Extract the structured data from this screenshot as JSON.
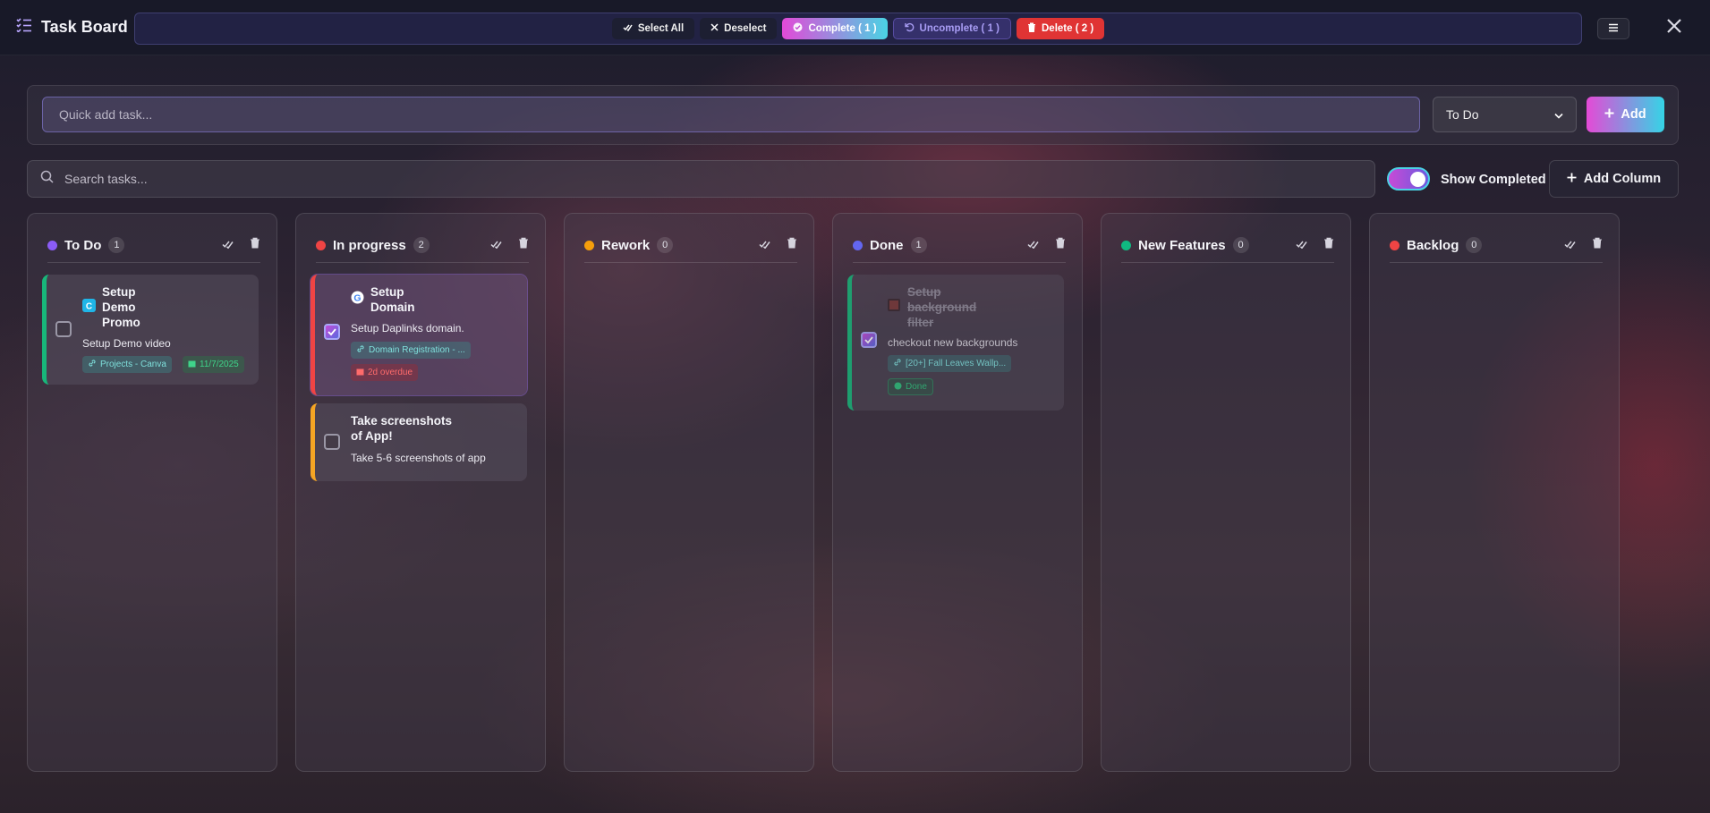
{
  "app": {
    "title": "Task Board"
  },
  "actions": {
    "select_all": "Select All",
    "deselect": "Deselect",
    "complete_label": "Complete ( 1 )",
    "uncomplete_label": "Uncomplete ( 1 )",
    "delete_label": "Delete ( 2 )"
  },
  "quick_add": {
    "placeholder": "Quick add task...",
    "column_value": "To Do",
    "add_label": "Add"
  },
  "search": {
    "placeholder": "Search tasks..."
  },
  "show_completed": {
    "label": "Show Completed",
    "on": true
  },
  "add_column_label": "Add Column",
  "columns": [
    {
      "title": "To Do",
      "count": "1",
      "color": "#8b5cf6",
      "cards": [
        {
          "title_lines": [
            "Setup",
            "Demo",
            "Promo"
          ],
          "description": "Setup Demo video",
          "link": "Projects - Canva",
          "date": "11/7/2025",
          "checked": false,
          "accent": "#18b77a",
          "icon": "canva-icon"
        }
      ]
    },
    {
      "title": "In progress",
      "count": "2",
      "color": "#ef4444",
      "cards": [
        {
          "title_lines": [
            "Setup",
            "Domain"
          ],
          "description": "Setup Daplinks domain.",
          "link": "Domain Registration - ...",
          "overdue": "2d overdue",
          "checked": true,
          "accent": "#ef4444",
          "icon": "google-icon"
        },
        {
          "title_lines": [
            "Take screenshots",
            "of App!"
          ],
          "description": "Take 5-6 screenshots of app",
          "checked": false,
          "accent": "#f5a524"
        }
      ]
    },
    {
      "title": "Rework",
      "count": "0",
      "color": "#f59e0b",
      "cards": []
    },
    {
      "title": "Done",
      "count": "1",
      "color": "#6366f1",
      "cards": [
        {
          "title_lines": [
            "Setup",
            "background",
            "filter"
          ],
          "description": "checkout new backgrounds",
          "link": "[20+] Fall Leaves Wallp...",
          "status": "Done",
          "checked": true,
          "accent": "#18b77a",
          "icon": "wallpaper-icon"
        }
      ]
    },
    {
      "title": "New Features",
      "count": "0",
      "color": "#10b981",
      "cards": []
    },
    {
      "title": "Backlog",
      "count": "0",
      "color": "#ef4444",
      "cards": []
    }
  ]
}
